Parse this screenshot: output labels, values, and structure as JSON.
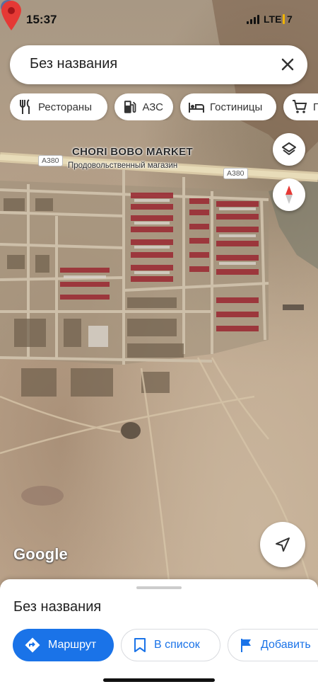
{
  "status_bar": {
    "time": "15:37",
    "network": "LTE",
    "battery_percent": "7",
    "battery_color": "#f0b400"
  },
  "search": {
    "query": "Без названия",
    "close_icon": "close-icon"
  },
  "categories": [
    {
      "label": "Рестораны",
      "icon": "restaurant-icon"
    },
    {
      "label": "АЗС",
      "icon": "gas-station-icon"
    },
    {
      "label": "Гостиницы",
      "icon": "hotel-icon"
    },
    {
      "label": "П",
      "icon": "shopping-cart-icon"
    }
  ],
  "map": {
    "poi_name": "CHORI BOBO MARKET",
    "poi_category": "Продовольственный магазин",
    "road_labels": [
      "A380",
      "A380"
    ],
    "logo_text": "Google",
    "pin_color": "#e53935",
    "poi_pin_color": "#4285f4",
    "buttons": [
      "layers-icon",
      "compass-icon",
      "my-location-icon"
    ]
  },
  "place_sheet": {
    "title": "Без названия",
    "actions": [
      {
        "label": "Маршрут",
        "icon": "directions-icon",
        "primary": true
      },
      {
        "label": "В список",
        "icon": "bookmark-icon",
        "primary": false
      },
      {
        "label": "Добавить",
        "icon": "flag-icon",
        "primary": false
      }
    ],
    "accent_color": "#1a73e8"
  }
}
